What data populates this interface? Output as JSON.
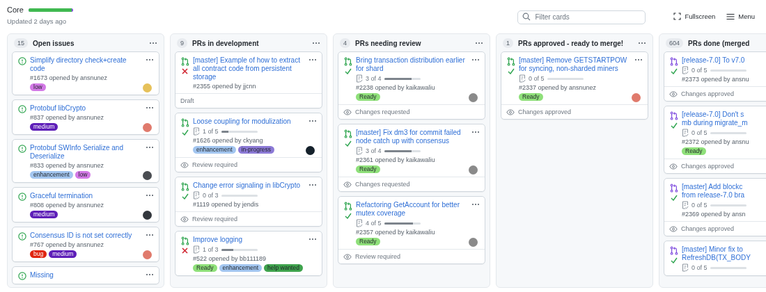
{
  "project": {
    "title": "Core",
    "progress": {
      "level": 0.97
    },
    "updated": "Updated 2 days ago"
  },
  "search": {
    "placeholder": "Filter cards"
  },
  "actions": [
    {
      "kind": "fullscreen",
      "label": "Fullscreen"
    },
    {
      "kind": "menu",
      "label": "Menu"
    }
  ],
  "columns": [
    {
      "count": "15",
      "name": "Open issues",
      "cards": [
        {
          "kind": "issue",
          "title": "Simplify directory check+create code",
          "meta": "#1673 opened by ansnunez",
          "labels": [
            {
              "name": "low",
              "color": "#d379e6"
            }
          ],
          "avatar": {
            "color": "#e6c15a"
          }
        },
        {
          "kind": "issue",
          "title": "Protobuf libCrypto",
          "meta": "#837 opened by ansnunez",
          "labels": [
            {
              "name": "medium",
              "color": "#5e1fb8"
            }
          ],
          "avatar": {
            "color": "#e07a6c"
          }
        },
        {
          "kind": "issue",
          "title": "Protobuf SWInfo Serialize and Deserialize",
          "meta": "#833 opened by ansnunez",
          "labels": [
            {
              "name": "enhancement",
              "color": "#a3c6f0"
            },
            {
              "name": "low",
              "color": "#d379e6"
            }
          ],
          "avatar": {
            "color": "#4a4d52"
          }
        },
        {
          "kind": "issue",
          "title": "Graceful termination",
          "meta": "#808 opened by ansnunez",
          "labels": [
            {
              "name": "medium",
              "color": "#5e1fb8"
            }
          ],
          "avatar": {
            "color": "#33373d"
          }
        },
        {
          "kind": "issue",
          "title": "Consensus ID is not set correctly",
          "meta": "#767 opened by ansnunez",
          "labels": [
            {
              "name": "bug",
              "color": "#e0250f"
            },
            {
              "name": "medium",
              "color": "#5e1fb8"
            }
          ],
          "avatar": {
            "color": "#e07a6c"
          }
        },
        {
          "kind": "issue",
          "title": "Missing"
        }
      ]
    },
    {
      "count": "9",
      "name": "PRs in development",
      "cards": [
        {
          "kind": "pr",
          "ci_passed": false,
          "title": "[master] Example of how to extract all contract code from persistent storage",
          "meta": "#2355 opened by jjcnn",
          "footer": {
            "kind": "draft",
            "text": "Draft"
          }
        },
        {
          "kind": "pr",
          "ci_passed": true,
          "title": "Loose coupling for modulization",
          "tasks": {
            "text": "1 of 5",
            "level": 0.2
          },
          "meta": "#1626 opened by ckyang",
          "labels": [
            {
              "name": "enhancement",
              "color": "#a3c6f0"
            },
            {
              "name": "in-progress",
              "color": "#8c7ad6"
            }
          ],
          "avatar": {
            "color": "#15212b"
          },
          "footer": {
            "kind": "review",
            "text": "Review required"
          }
        },
        {
          "kind": "pr",
          "ci_passed": true,
          "title": "Change error signaling in libCrypto",
          "tasks": {
            "text": "0 of 3",
            "level": 0
          },
          "meta": "#1119 opened by jendis",
          "footer": {
            "kind": "review",
            "text": "Review required"
          }
        },
        {
          "kind": "pr",
          "ci_passed": false,
          "title": "Improve logging",
          "tasks": {
            "text": "1 of 3",
            "level": 0.33
          },
          "meta": "#522 opened by bb111189",
          "labels": [
            {
              "name": "Ready",
              "color": "#8fe07a"
            },
            {
              "name": "enhancement",
              "color": "#a3c6f0"
            },
            {
              "name": "help wanted",
              "color": "#3fa34d"
            }
          ]
        }
      ]
    },
    {
      "count": "4",
      "name": "PRs needing review",
      "cards": [
        {
          "kind": "pr",
          "ci_passed": true,
          "title": "Bring transaction distribution earlier for shard",
          "tasks": {
            "text": "3 of 4",
            "level": 0.75
          },
          "meta": "#2238 opened by kaikawaliu",
          "labels": [
            {
              "name": "Ready",
              "color": "#8fe07a"
            }
          ],
          "avatar": {
            "color": "#8a8a8a"
          },
          "footer": {
            "kind": "review",
            "text": "Changes requested"
          }
        },
        {
          "kind": "pr",
          "ci_passed": true,
          "title": "[master] Fix dm3 for commit failed node catch up with consensus",
          "tasks": {
            "text": "3 of 4",
            "level": 0.75
          },
          "meta": "#2361 opened by kaikawaliu",
          "labels": [
            {
              "name": "Ready",
              "color": "#8fe07a"
            }
          ],
          "avatar": {
            "color": "#8a8a8a"
          },
          "footer": {
            "kind": "review",
            "text": "Changes requested"
          }
        },
        {
          "kind": "pr",
          "ci_passed": true,
          "title": "Refactoring GetAccount for better mutex coverage",
          "tasks": {
            "text": "4 of 5",
            "level": 0.8
          },
          "meta": "#2357 opened by kaikawaliu",
          "labels": [
            {
              "name": "Ready",
              "color": "#8fe07a"
            }
          ],
          "avatar": {
            "color": "#8a8a8a"
          },
          "footer": {
            "kind": "review",
            "text": "Review required"
          }
        }
      ]
    },
    {
      "count": "1",
      "name": "PRs approved - ready to merge!",
      "cards": [
        {
          "kind": "pr",
          "ci_passed": true,
          "title": "[master] Remove GETSTARTPOW for syncing, non-sharded miners",
          "tasks": {
            "text": "0 of 5",
            "level": 0
          },
          "meta": "#2337 opened by ansnunez",
          "labels": [
            {
              "name": "Ready",
              "color": "#8fe07a"
            }
          ],
          "avatar": {
            "color": "#e07a6c"
          },
          "footer": {
            "kind": "review",
            "text": "Changes approved"
          }
        }
      ]
    },
    {
      "count": "604",
      "name": "PRs done (merged",
      "cards": [
        {
          "kind": "merged",
          "ci_passed": true,
          "title": "[release-7.0] To v7.0",
          "tasks": {
            "text": "0 of 5",
            "level": 0
          },
          "meta": "#2373 opened by ansnu",
          "footer": {
            "kind": "review",
            "text": "Changes approved"
          }
        },
        {
          "kind": "merged",
          "ci_passed": true,
          "title": "[release-7.0] Don't s\nmb during migrate_m",
          "tasks": {
            "text": "0 of 5",
            "level": 0
          },
          "meta": "#2372 opened by ansnu",
          "labels": [
            {
              "name": "Ready",
              "color": "#8fe07a"
            }
          ],
          "footer": {
            "kind": "review",
            "text": "Changes approved"
          }
        },
        {
          "kind": "merged",
          "ci_passed": true,
          "title": "[master] Add blockc\nfrom release-7.0 bra",
          "tasks": {
            "text": "0 of 5",
            "level": 0
          },
          "meta": "#2369 opened by ansn",
          "footer": {
            "kind": "review",
            "text": "Changes approved"
          }
        },
        {
          "kind": "merged",
          "ci_passed": true,
          "title": "[master] Minor fix to\nRefreshDB(TX_BODY",
          "tasks": {
            "text": "0 of 5",
            "level": 0
          }
        }
      ]
    }
  ]
}
